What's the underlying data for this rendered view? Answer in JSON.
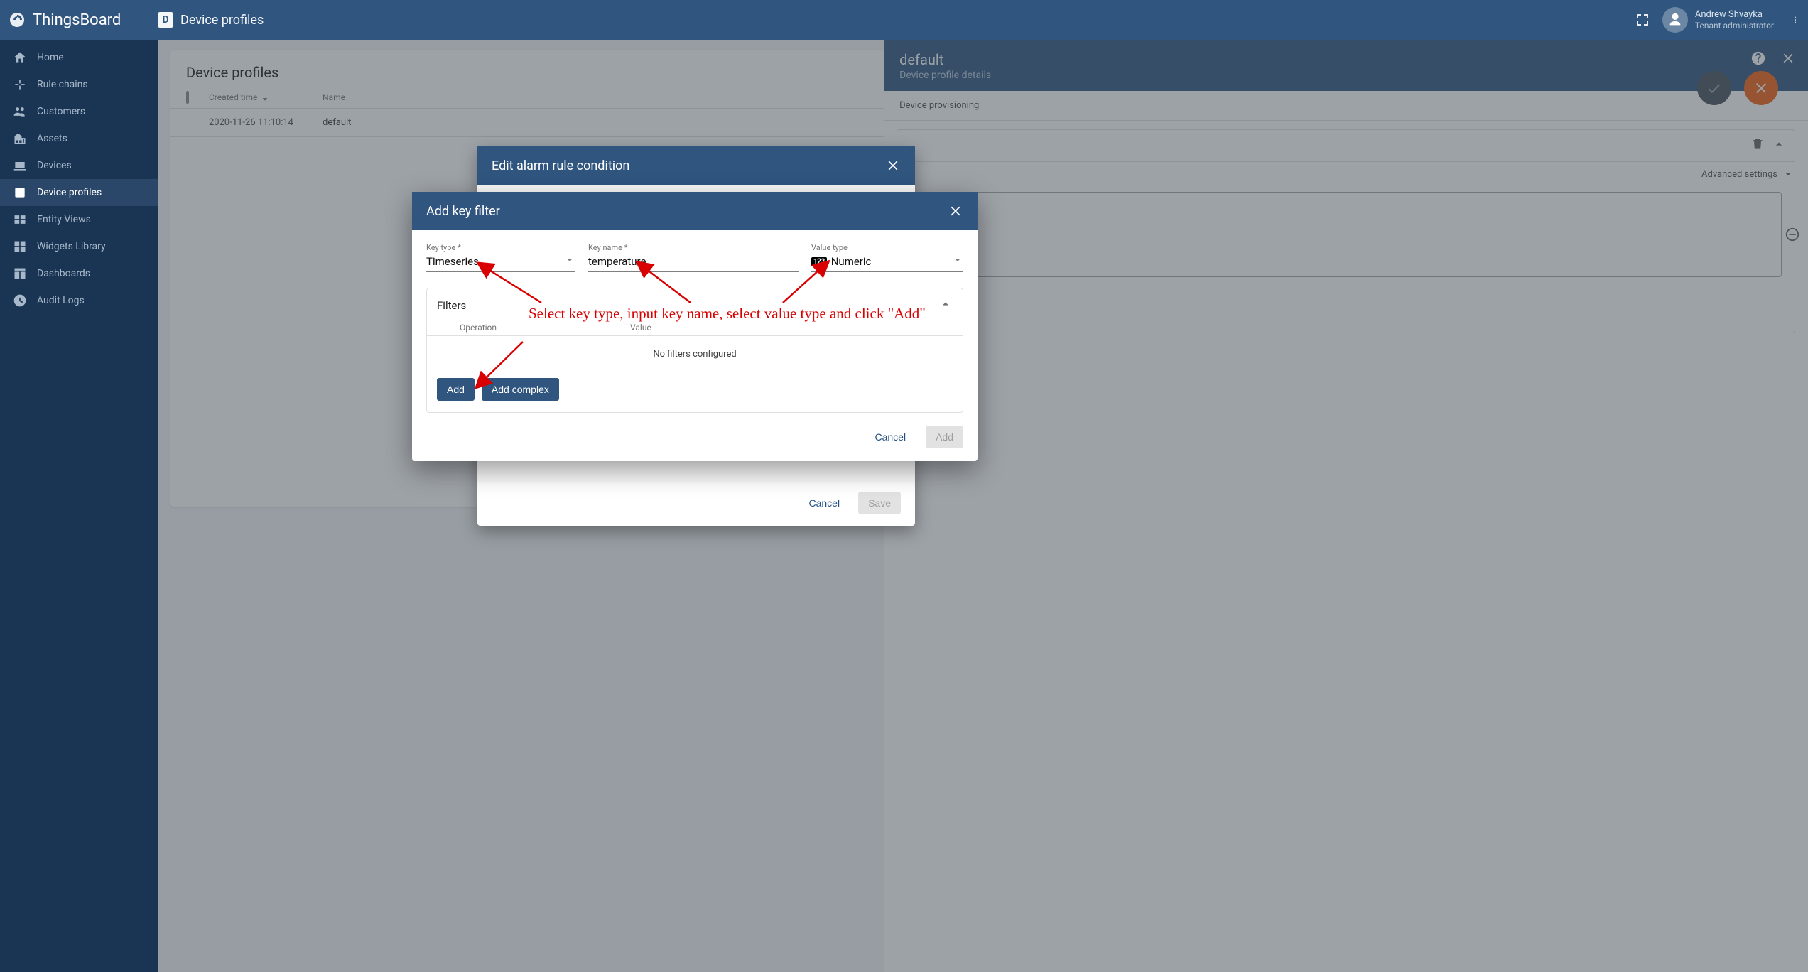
{
  "brand": "ThingsBoard",
  "breadcrumb": "Device profiles",
  "user": {
    "name": "Andrew Shvayka",
    "role": "Tenant administrator"
  },
  "sidebar": {
    "items": [
      {
        "label": "Home"
      },
      {
        "label": "Rule chains"
      },
      {
        "label": "Customers"
      },
      {
        "label": "Assets"
      },
      {
        "label": "Devices"
      },
      {
        "label": "Device profiles"
      },
      {
        "label": "Entity Views"
      },
      {
        "label": "Widgets Library"
      },
      {
        "label": "Dashboards"
      },
      {
        "label": "Audit Logs"
      }
    ]
  },
  "list": {
    "title": "Device profiles",
    "col_created": "Created time",
    "col_name": "Name",
    "rows": [
      {
        "created": "2020-11-26 11:10:14",
        "name": "default"
      }
    ]
  },
  "detail": {
    "title": "default",
    "subtitle": "Device profile details",
    "tab_provisioning": "Device provisioning",
    "advanced": "Advanced settings"
  },
  "dlg_outer": {
    "title": "Edit alarm rule condition",
    "cancel": "Cancel",
    "save": "Save"
  },
  "dlg_inner": {
    "title": "Add key filter",
    "key_type_label": "Key type *",
    "key_type_value": "Timeseries",
    "key_name_label": "Key name *",
    "key_name_value": "temperature",
    "value_type_label": "Value type",
    "value_type_badge": "123",
    "value_type_value": "Numeric",
    "filters_title": "Filters",
    "col_operation": "Operation",
    "col_value": "Value",
    "empty": "No filters configured",
    "add": "Add",
    "add_complex": "Add complex",
    "cancel": "Cancel",
    "confirm": "Add"
  },
  "anno_text": "Select key type, input key name, select value type and click \"Add\""
}
